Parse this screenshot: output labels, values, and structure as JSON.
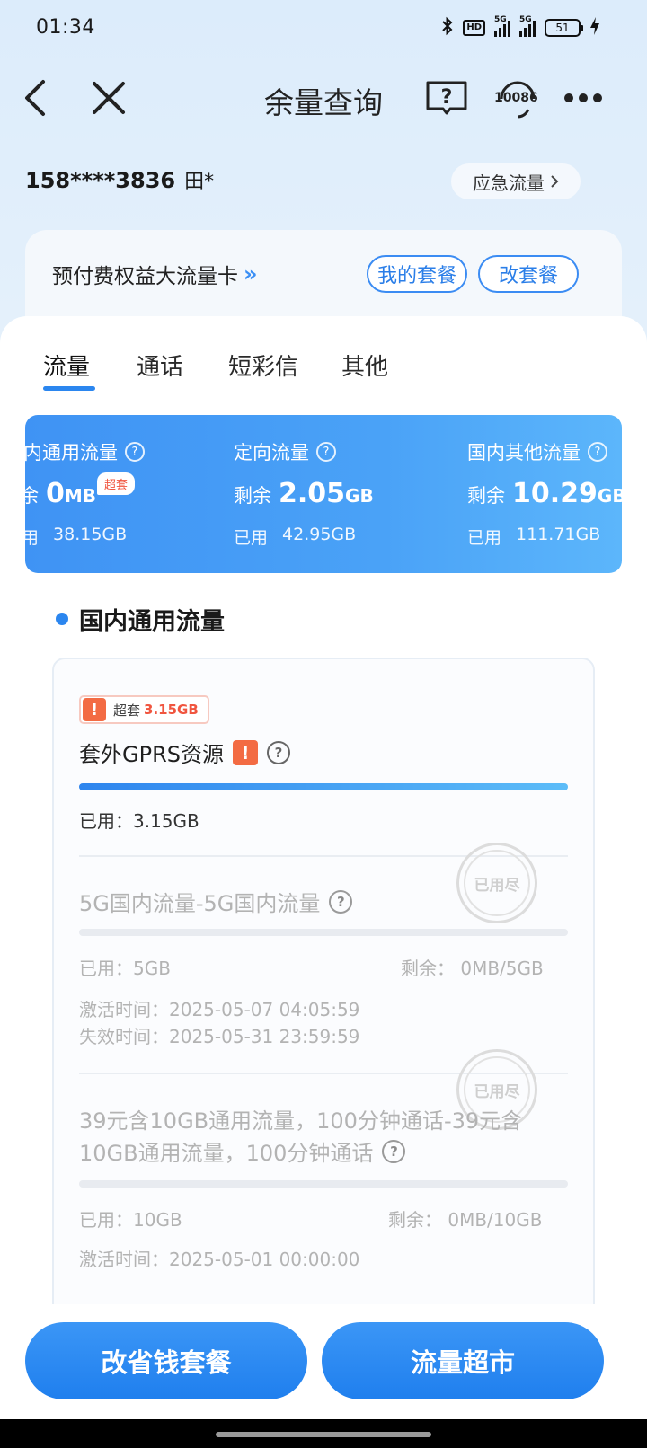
{
  "status": {
    "time": "01:34",
    "hd_label": "HD",
    "net1": "5G",
    "net2": "5G",
    "battery": "51"
  },
  "nav": {
    "title": "余量查询",
    "service_label": "10086"
  },
  "account": {
    "phone": "158****3836",
    "name": "田*",
    "emergency_label": "应急流量"
  },
  "plan": {
    "name": "预付费权益大流量卡",
    "my_plan_label": "我的套餐",
    "change_plan_label": "改套餐"
  },
  "tabs": [
    {
      "label": "流量"
    },
    {
      "label": "通话"
    },
    {
      "label": "短彩信"
    },
    {
      "label": "其他"
    }
  ],
  "summary": [
    {
      "title": "内通用流量",
      "remain_label": "余",
      "remain_value": "0",
      "remain_unit": "MB",
      "badge": "超套",
      "used_label": "用",
      "used_value": "38.15GB"
    },
    {
      "title": "定向流量",
      "remain_label": "剩余",
      "remain_value": "2.05",
      "remain_unit": "GB",
      "used_label": "已用",
      "used_value": "42.95GB"
    },
    {
      "title": "国内其他流量",
      "remain_label": "剩余",
      "remain_value": "10.29",
      "remain_unit": "GB",
      "used_label": "已用",
      "used_value": "111.71GB"
    }
  ],
  "section": {
    "title": "国内通用流量"
  },
  "overage": {
    "label": "超套",
    "value": "3.15GB"
  },
  "items": [
    {
      "title": "套外GPRS资源",
      "used_text": "已用：3.15GB",
      "progress": 1.0
    },
    {
      "title": "5G国内流量-5G国内流量",
      "used_text": "已用：5GB",
      "remain_text": "剩余：  0MB/5GB",
      "activate_text": "激活时间：2025-05-07 04:05:59",
      "expire_text": "失效时间：2025-05-31 23:59:59",
      "stamp_text": "已用尽",
      "progress": 0.0
    },
    {
      "title_line1": "39元含10GB通用流量，100分钟通话-39元含",
      "title_line2": "10GB通用流量，100分钟通话",
      "used_text": "已用：10GB",
      "remain_text": "剩余：  0MB/10GB",
      "activate_text": "激活时间：2025-05-01 00:00:00",
      "stamp_text": "已用尽",
      "progress": 0.0
    }
  ],
  "bottom": {
    "save_plan_label": "改省钱套餐",
    "market_label": "流量超市"
  },
  "colors": {
    "accent": "#2b86ef",
    "warning": "#f36b43",
    "overage_text": "#f0553f"
  }
}
